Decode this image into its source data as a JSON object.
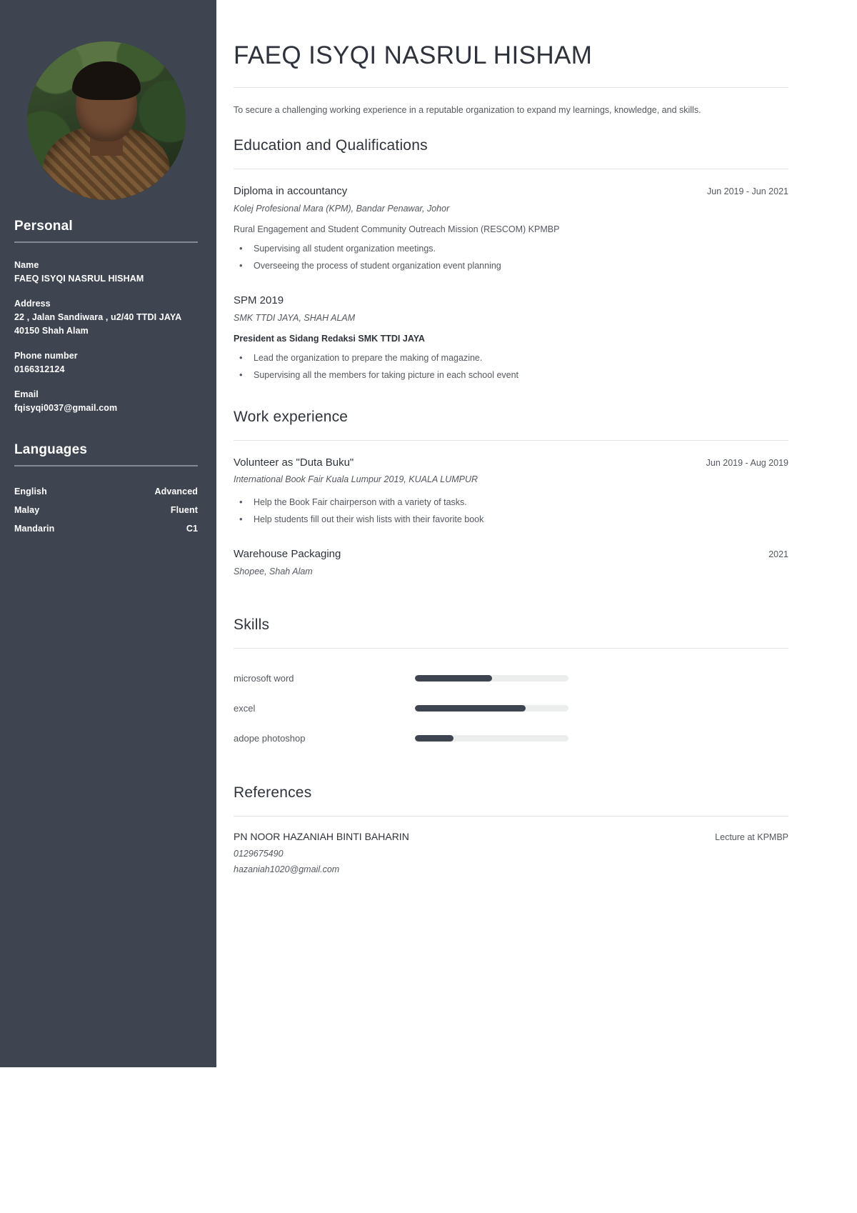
{
  "sidebar": {
    "avatar_alt": "profile-photo",
    "personal": {
      "heading": "Personal",
      "fields": [
        {
          "label": "Name",
          "value": "FAEQ ISYQI NASRUL HISHAM"
        },
        {
          "label": "Address",
          "value": "22 , Jalan Sandiwara , u2/40 TTDI JAYA\n40150 Shah Alam"
        },
        {
          "label": "Phone number",
          "value": "0166312124"
        },
        {
          "label": "Email",
          "value": "fqisyqi0037@gmail.com"
        }
      ]
    },
    "languages": {
      "heading": "Languages",
      "items": [
        {
          "name": "English",
          "level": "Advanced"
        },
        {
          "name": "Malay",
          "level": "Fluent"
        },
        {
          "name": "Mandarin",
          "level": "C1"
        }
      ]
    }
  },
  "main": {
    "name": "FAEQ ISYQI NASRUL HISHAM",
    "summary": "To secure a challenging working experience in a reputable organization to expand my learnings, knowledge, and skills.",
    "education": {
      "heading": "Education and Qualifications",
      "entries": [
        {
          "title": "Diploma in accountancy",
          "date": "Jun 2019 - Jun 2021",
          "org": "Kolej Profesional Mara (KPM), Bandar Penawar, Johor",
          "sub": "Rural Engagement and Student Community Outreach Mission (RESCOM) KPMBP",
          "sub_bold": false,
          "bullets": [
            "Supervising all student organization meetings.",
            "Overseeing the process of student organization event planning"
          ]
        },
        {
          "title": "SPM 2019",
          "date": "",
          "org": "SMK TTDI JAYA, SHAH ALAM",
          "sub": "President as Sidang Redaksi SMK TTDI JAYA",
          "sub_bold": true,
          "bullets": [
            "Lead the organization to prepare the making of magazine.",
            "Supervising all the members for taking picture in each school event"
          ]
        }
      ]
    },
    "work": {
      "heading": "Work experience",
      "entries": [
        {
          "title": "Volunteer as \"Duta Buku\"",
          "date": "Jun 2019 - Aug 2019",
          "org": "International Book Fair Kuala Lumpur 2019, KUALA LUMPUR",
          "sub": "",
          "sub_bold": false,
          "bullets": [
            "Help the Book Fair chairperson with a variety of tasks.",
            "Help students fill out their wish lists with their favorite book"
          ]
        },
        {
          "title": "Warehouse Packaging",
          "date": "2021",
          "org": "Shopee, Shah Alam",
          "sub": "",
          "sub_bold": false,
          "bullets": []
        }
      ]
    },
    "skills": {
      "heading": "Skills",
      "items": [
        {
          "name": "microsoft word",
          "level": 50
        },
        {
          "name": "excel",
          "level": 72
        },
        {
          "name": "adope photoshop",
          "level": 25
        }
      ]
    },
    "references": {
      "heading": "References",
      "entries": [
        {
          "name": "PN NOOR HAZANIAH BINTI BAHARIN",
          "role": "Lecture at KPMBP",
          "phone": "0129675490",
          "email": "hazaniah1020@gmail.com"
        }
      ]
    }
  },
  "colors": {
    "sidebar_bg": "#3e4450",
    "text_dark": "#2e333b",
    "text_muted": "#54585f",
    "rule": "#e3e4e6",
    "skill_track": "#eceded",
    "skill_fill": "#3e4450"
  }
}
